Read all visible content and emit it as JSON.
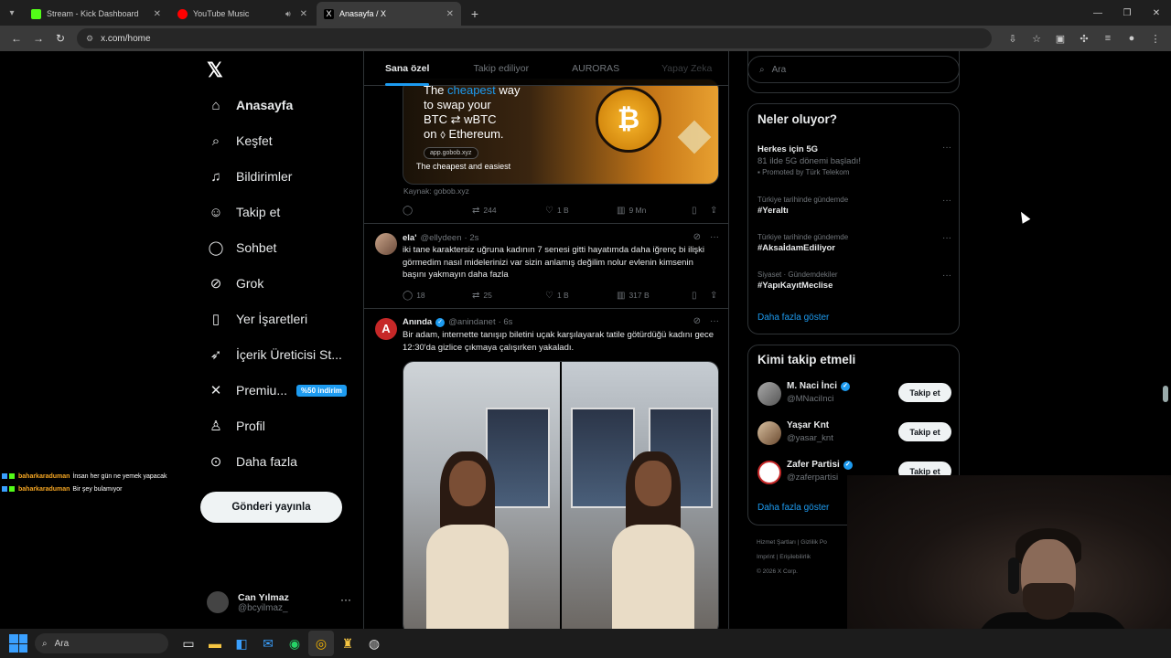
{
  "browser": {
    "tabs": [
      {
        "title": "Stream - Kick Dashboard",
        "color": "#53fc18"
      },
      {
        "title": "YouTube Music",
        "color": "#ff0000"
      },
      {
        "title": "Anasayfa / X",
        "color": "#ffffff"
      }
    ],
    "url": "x.com/home"
  },
  "leftnav": {
    "items": [
      {
        "label": "Anasayfa",
        "icon": "home-icon"
      },
      {
        "label": "Keşfet",
        "icon": "search-icon"
      },
      {
        "label": "Bildirimler",
        "icon": "bell-icon"
      },
      {
        "label": "Takip et",
        "icon": "add-person-icon"
      },
      {
        "label": "Sohbet",
        "icon": "chat-icon"
      },
      {
        "label": "Grok",
        "icon": "grok-icon"
      },
      {
        "label": "Yer İşaretleri",
        "icon": "bookmark-icon"
      },
      {
        "label": "İçerik Üreticisi St...",
        "icon": "rocket-icon"
      },
      {
        "label": "Premiu...",
        "icon": "x-icon"
      },
      {
        "label": "Profil",
        "icon": "person-icon"
      },
      {
        "label": "Daha fazla",
        "icon": "more-circle-icon"
      }
    ],
    "premium_badge": "%50 indirim",
    "post_button": "Gönderi yayınla",
    "account": {
      "name": "Can Yılmaz",
      "handle": "@bcyilmaz_"
    }
  },
  "feed": {
    "tabs": [
      "Sana özel",
      "Takip ediliyor",
      "AURORAS",
      "Yapay Zeka"
    ],
    "ad": {
      "line1_pre": "The ",
      "line1_hl": "cheapest",
      "line1_post": " way",
      "line2": "to swap your",
      "line3": "BTC ⇄ wBTC",
      "line4": "on ⬨ Ethereum.",
      "chip": "app.gobob.xyz",
      "caption": "The cheapest and easiest",
      "source": "Kaynak: gobob.xyz",
      "stats": {
        "reposts": "244",
        "likes": "1 B",
        "views": "9 Mn"
      }
    },
    "tweets": [
      {
        "name": "ela'",
        "handle": "@ellydeen",
        "time": "· 2s",
        "text": "iki tane karaktersiz uğruna kadının 7 senesi gitti hayatımda daha iğrenç bi ilişki görmedim nasıl midelerinizi var sizin anlamış değilim nolur evlenin kimsenin başını yakmayın daha fazla",
        "replies": "18",
        "reposts": "25",
        "likes": "1 B",
        "views": "317 B"
      },
      {
        "name": "Anında",
        "handle": "@anindanet",
        "time": "· 6s",
        "text": "Bir adam, internette tanışıp biletini uçak karşılayarak tatile götürdüğü kadını gece 12:30'da gizlice çıkmaya çalışırken yakaladı."
      }
    ]
  },
  "right": {
    "search_placeholder": "Ara",
    "trends_title": "Neler oluyor?",
    "trends": [
      {
        "ctx": "",
        "title": "Herkes için 5G",
        "sub": "81 ilde 5G dönemi başladı!",
        "promo": "Promoted by Türk Telekom"
      },
      {
        "ctx": "Türkiye tarihinde gündemde",
        "title": "#Yeraltı"
      },
      {
        "ctx": "Türkiye tarihinde gündemde",
        "title": "#AksaİdamEdiliyor"
      },
      {
        "ctx": "Siyaset · Gündemdekiler",
        "title": "#YapıKayıtMeclise"
      }
    ],
    "show_more": "Daha fazla göster",
    "follow_title": "Kimi takip etmeli",
    "follow": [
      {
        "name": "M. Naci İnci",
        "handle": "@MNaciInci",
        "verified": true
      },
      {
        "name": "Yaşar Knt",
        "handle": "@yasar_knt",
        "verified": false
      },
      {
        "name": "Zafer Partisi",
        "handle": "@zaferpartisi",
        "verified": true
      }
    ],
    "follow_btn": "Takip et",
    "footer": [
      "Hizmet Şartları",
      "Gizlilik Po",
      "Imprint",
      "Erişilebilirlik",
      "© 2026 X Corp."
    ]
  },
  "chat": [
    {
      "user": "baharkaraduman",
      "msg": "İnsan her gün ne yemek yapacak"
    },
    {
      "user": "baharkaraduman",
      "msg": "Bir şey bulamıyor"
    }
  ],
  "taskbar": {
    "search": "Ara"
  }
}
